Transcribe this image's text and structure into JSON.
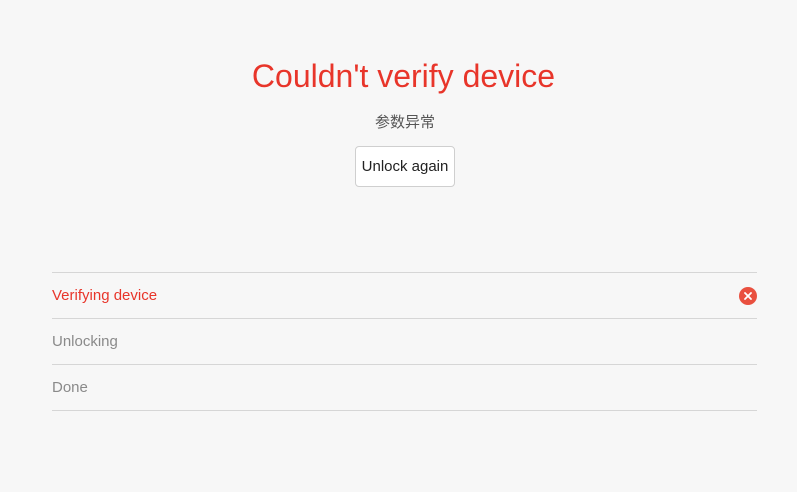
{
  "dialog": {
    "title": "Couldn't verify device",
    "subtitle": "参数异常",
    "unlock_again_label": "Unlock again"
  },
  "steps": [
    {
      "label": "Verifying device",
      "status": "error",
      "icon": "close-circle-icon"
    },
    {
      "label": "Unlocking",
      "status": "pending"
    },
    {
      "label": "Done",
      "status": "pending"
    }
  ],
  "colors": {
    "error": "#e8352a",
    "pending_text": "#8a8a8a",
    "background": "#f7f7f7"
  }
}
